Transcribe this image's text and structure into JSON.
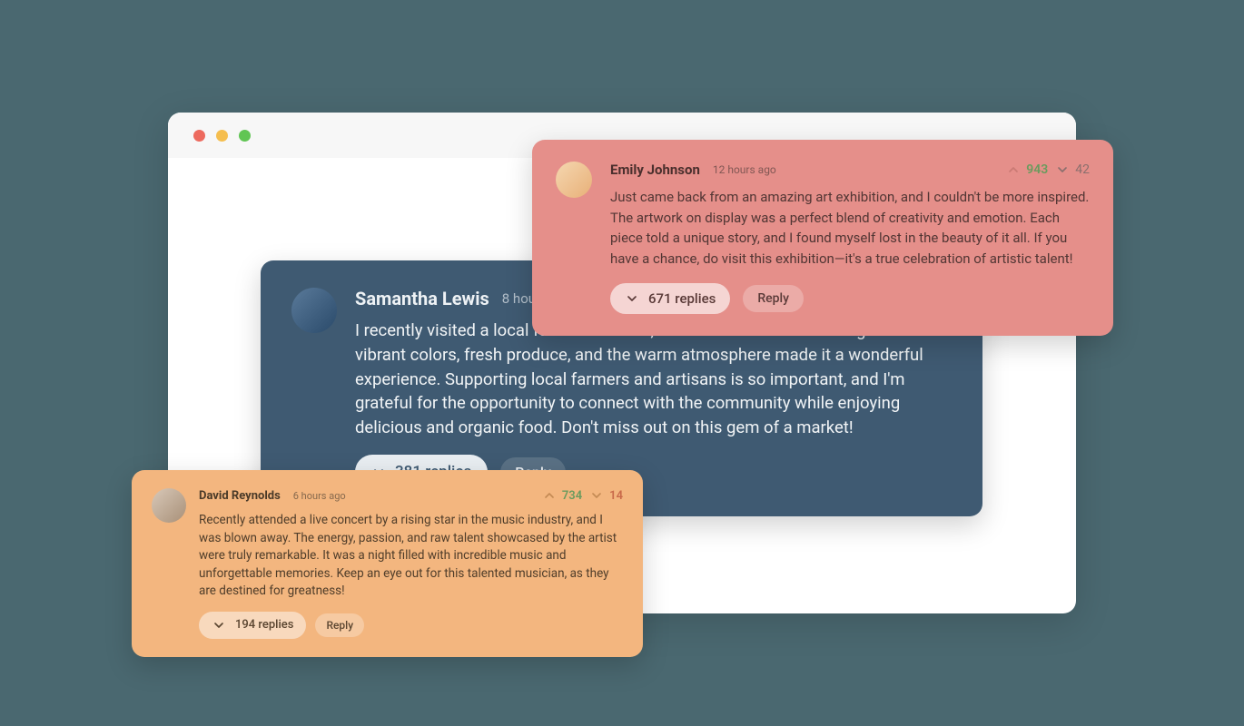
{
  "window": {
    "dots": [
      "close",
      "minimize",
      "maximize"
    ]
  },
  "comments": {
    "main": {
      "author": "Samantha Lewis",
      "timestamp": "8 hours ago",
      "text": "I recently visited a local farmer's market, and it was an absolute delight. The vibrant colors, fresh produce, and the warm atmosphere made it a wonderful experience. Supporting local farmers and artisans is so important, and I'm grateful for the opportunity to connect with the community while enjoying delicious and organic food. Don't miss out on this gem of a market!",
      "replies_label": "381 replies",
      "reply_label": "Reply"
    },
    "topRight": {
      "author": "Emily Johnson",
      "timestamp": "12 hours ago",
      "upvotes": "943",
      "downvotes": "42",
      "text": "Just came back from an amazing art exhibition, and I couldn't be more inspired. The artwork on display was a perfect blend of creativity and emotion. Each piece told a unique story, and I found myself lost in the beauty of it all. If you have a chance, do visit this exhibition—it's a true celebration of artistic talent!",
      "replies_label": "671 replies",
      "reply_label": "Reply"
    },
    "bottomLeft": {
      "author": "David Reynolds",
      "timestamp": "6 hours ago",
      "upvotes": "734",
      "downvotes": "14",
      "text": "Recently attended a live concert by a rising star in the music industry, and I was blown away. The energy, passion, and raw talent showcased by the artist were truly remarkable. It was a night filled with incredible music and unforgettable memories. Keep an eye out for this talented musician, as they are destined for greatness!",
      "replies_label": "194 replies",
      "reply_label": "Reply"
    }
  }
}
